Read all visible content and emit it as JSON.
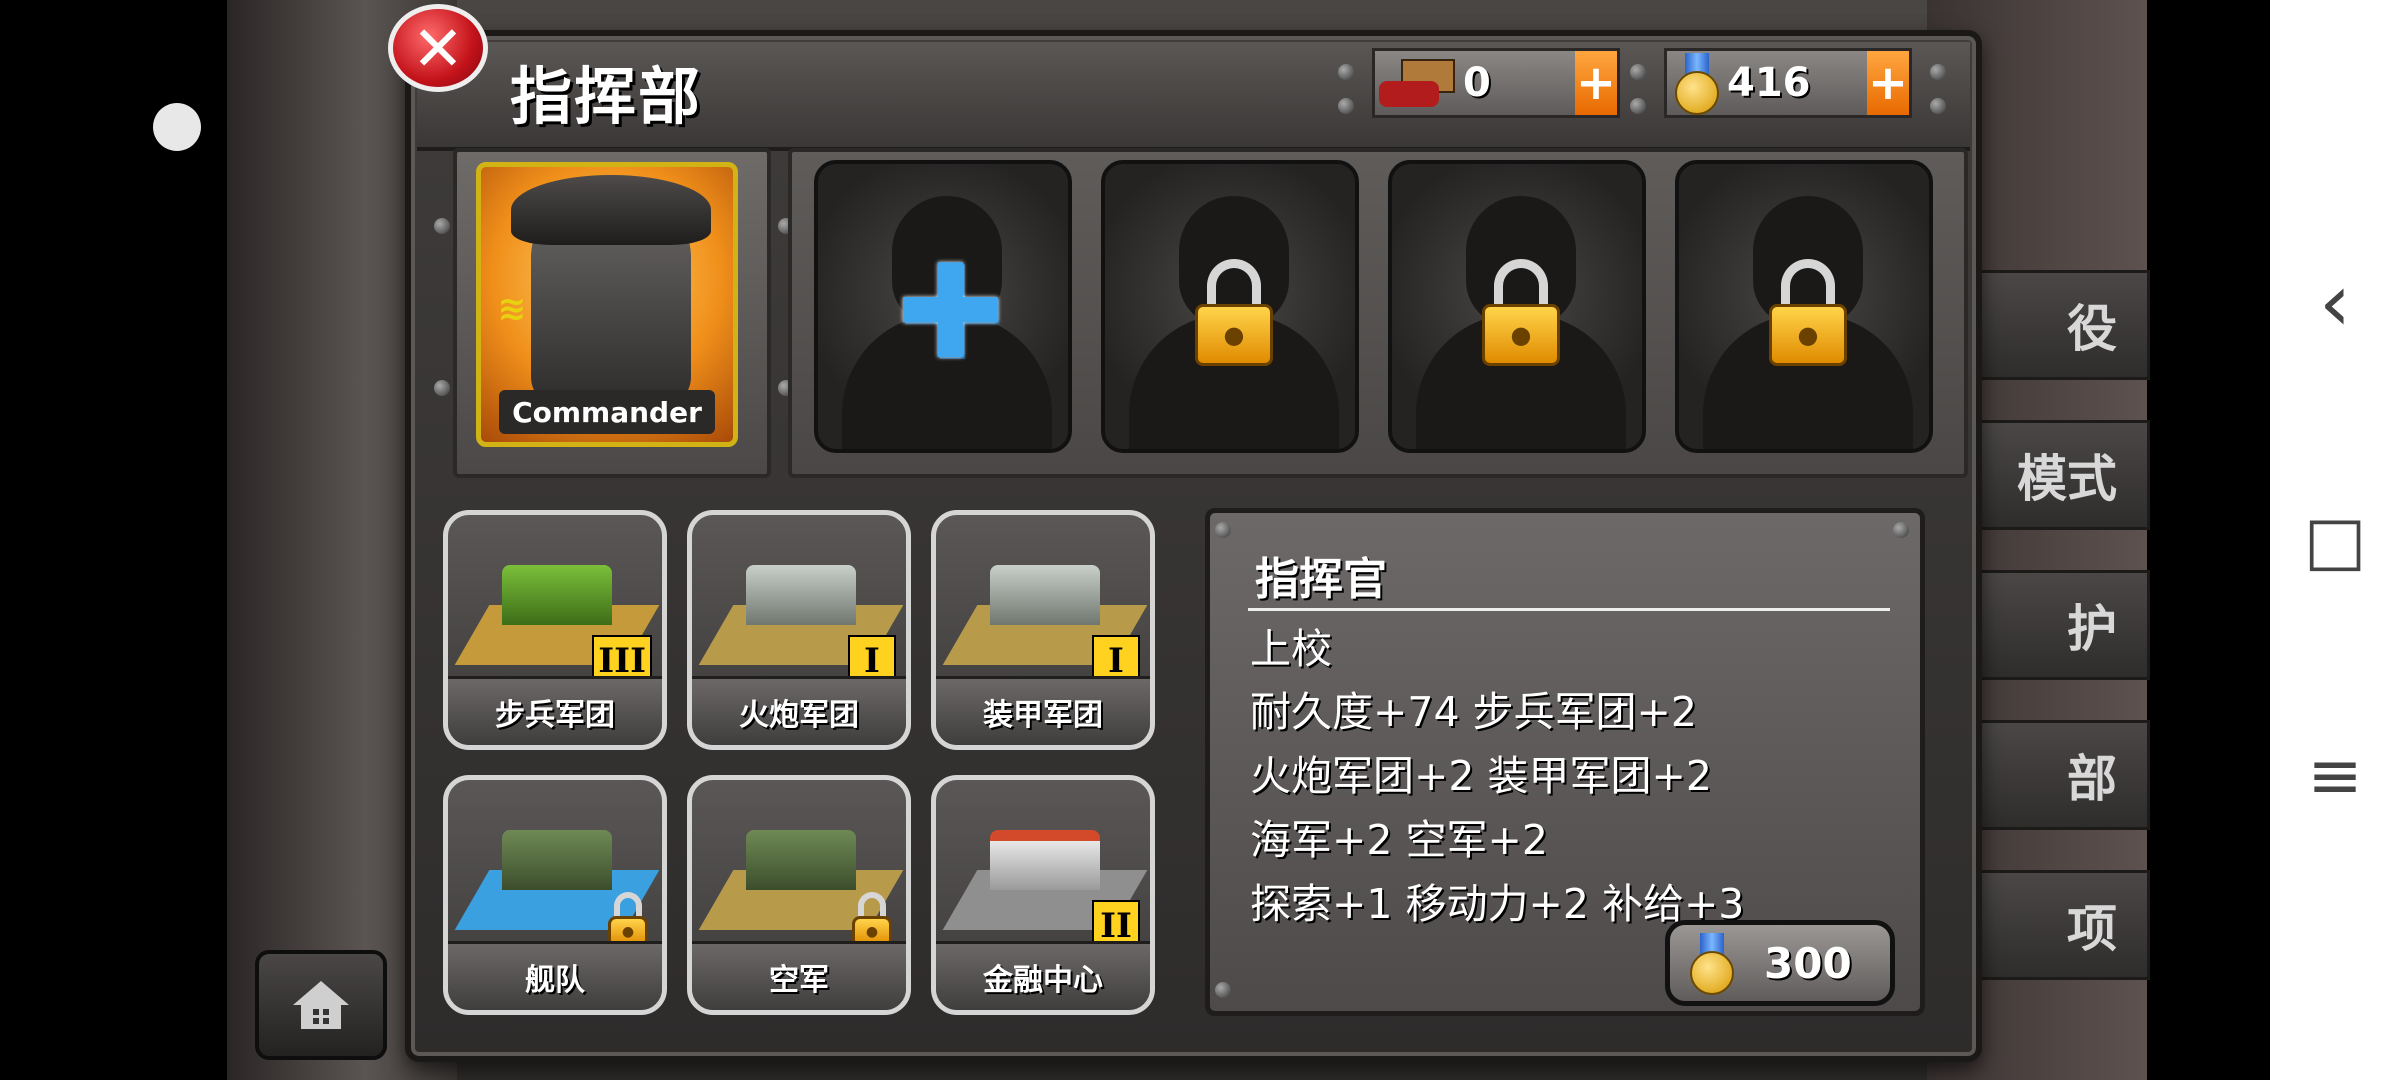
{
  "header": {
    "title": "指挥部",
    "close_label": "✕"
  },
  "resources": [
    {
      "name": "supply",
      "value": "0",
      "icon": "supply-truck-icon"
    },
    {
      "name": "medals",
      "value": "416",
      "icon": "medal-icon"
    }
  ],
  "commander": {
    "label": "Commander",
    "rank_glyph": "≋"
  },
  "slots": [
    {
      "state": "add",
      "glyph": "✚"
    },
    {
      "state": "locked"
    },
    {
      "state": "locked"
    },
    {
      "state": "locked"
    }
  ],
  "buildings": [
    {
      "name": "步兵军团",
      "level": "III",
      "locked": false
    },
    {
      "name": "火炮军团",
      "level": "I",
      "locked": false
    },
    {
      "name": "装甲军团",
      "level": "I",
      "locked": false
    },
    {
      "name": "舰队",
      "level": "",
      "locked": true
    },
    {
      "name": "空军",
      "level": "",
      "locked": true
    },
    {
      "name": "金融中心",
      "level": "II",
      "locked": false
    }
  ],
  "info": {
    "title": "指挥官",
    "lines": [
      "上校",
      "耐久度+74  步兵军团+2",
      "火炮军团+2  装甲军团+2",
      "海军+2  空军+2",
      "探索+1  移动力+2  补给+3"
    ],
    "cost": "300"
  },
  "side_menu": [
    "役",
    "模式",
    "护",
    "部",
    "项"
  ],
  "nav": {
    "back": "‹",
    "home": "□",
    "menu": "≡"
  }
}
